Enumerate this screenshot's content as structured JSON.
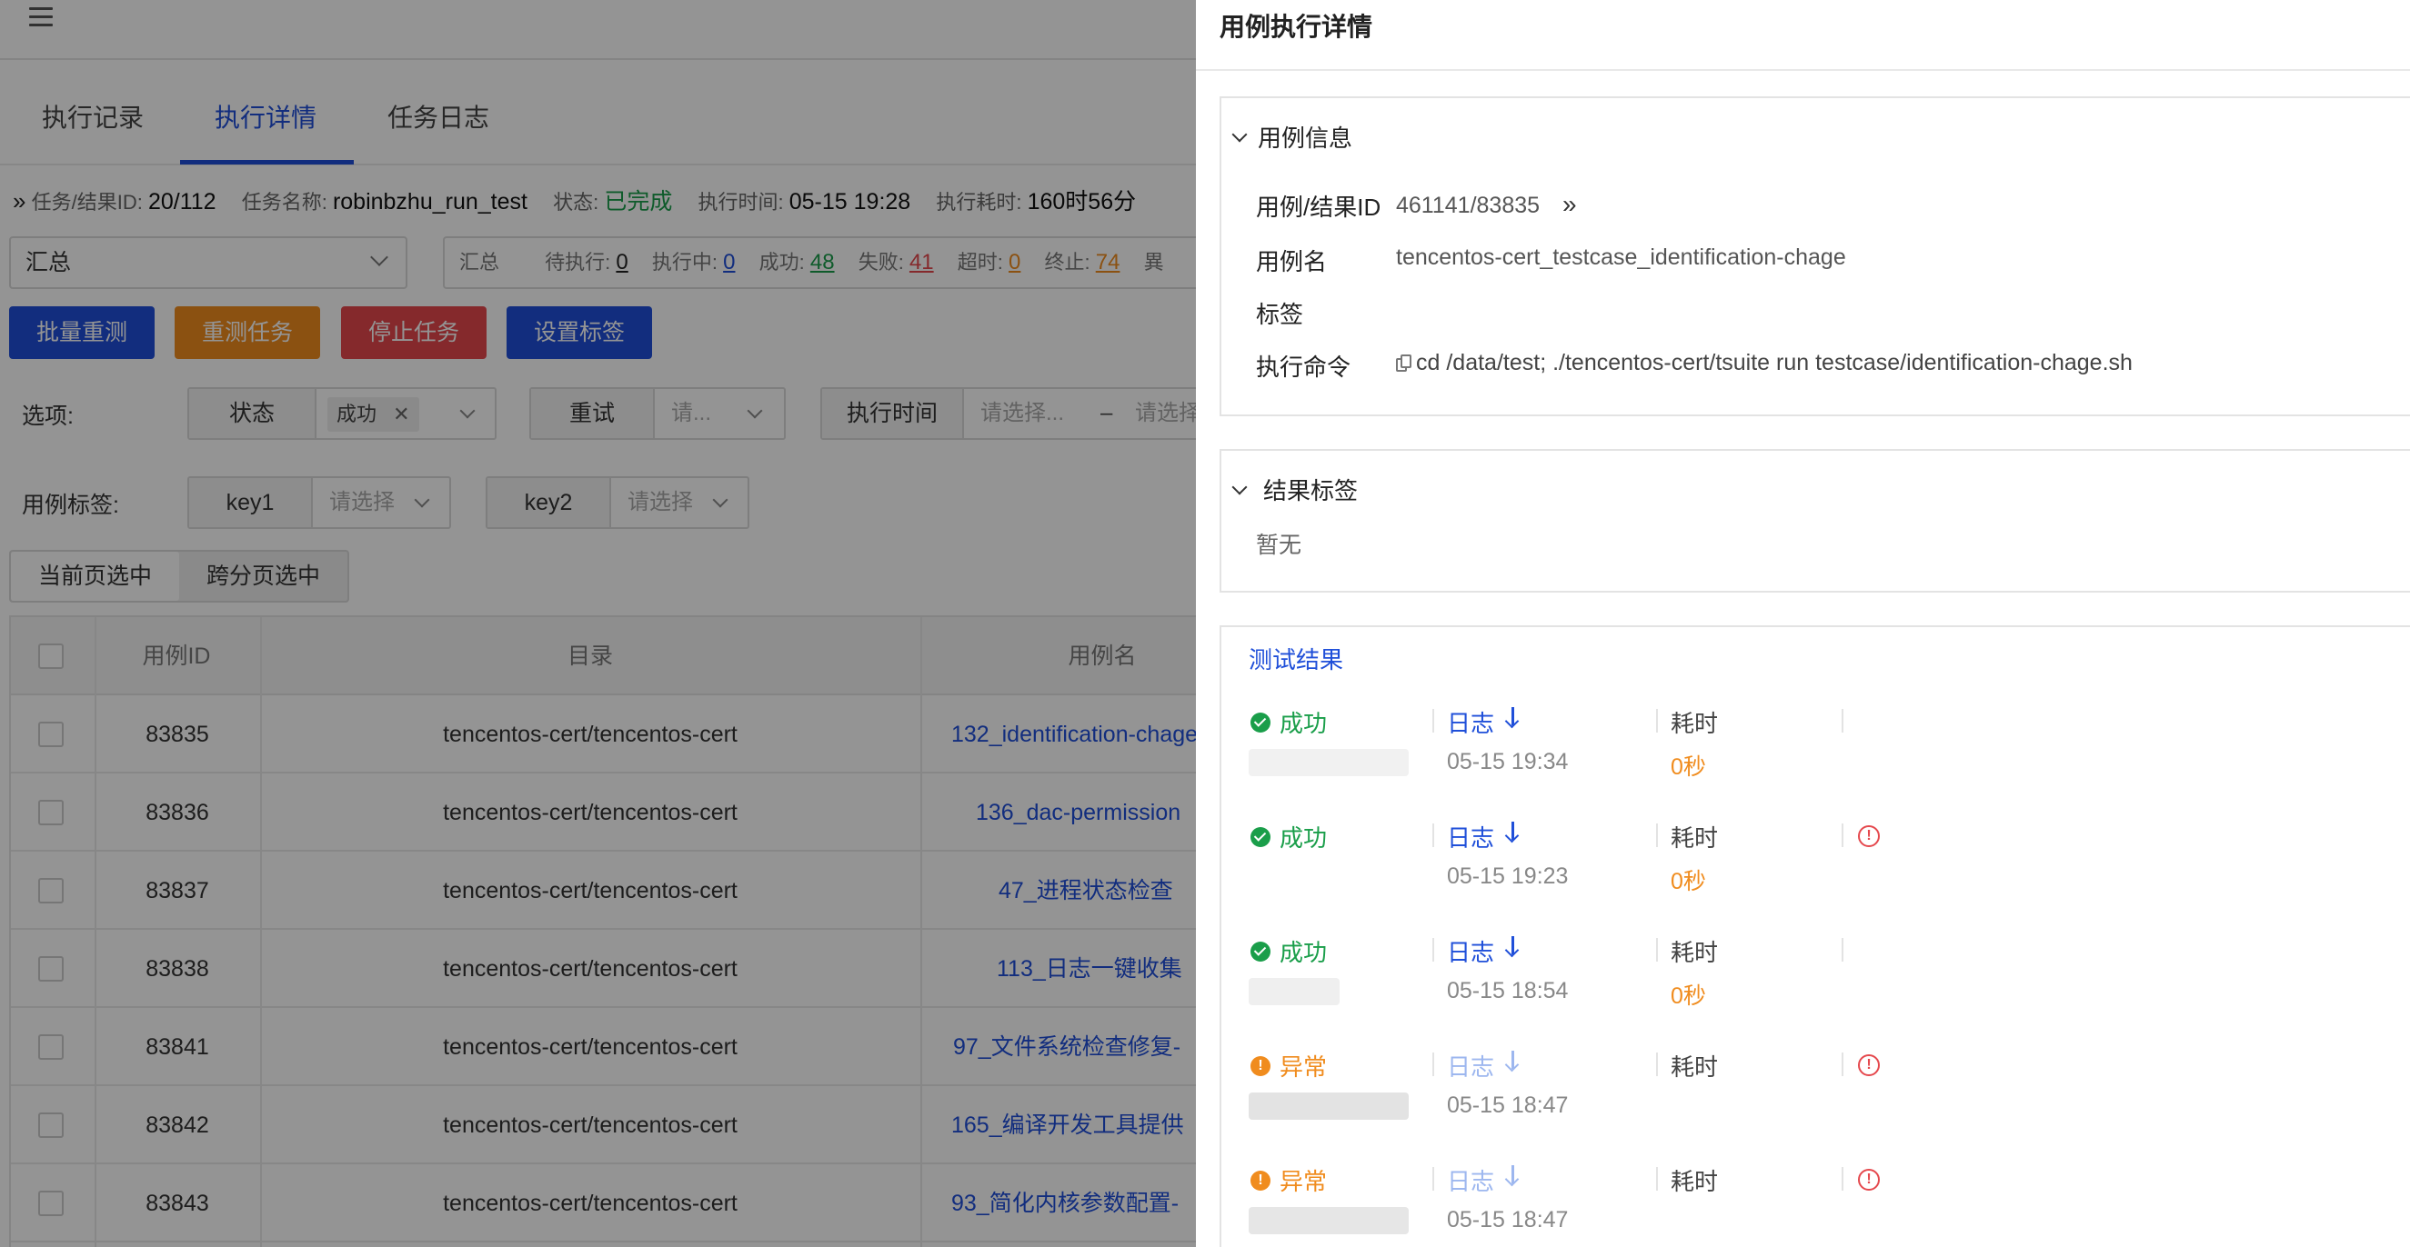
{
  "left": {
    "tabs": [
      "执行记录",
      "执行详情",
      "任务日志"
    ],
    "info": {
      "id_label": "任务/结果ID:",
      "id_value": "20/112",
      "name_label": "任务名称:",
      "name_value": "robinbzhu_run_test",
      "status_label": "状态:",
      "status_value": "已完成",
      "time_label": "执行时间:",
      "time_value": "05-15 19:28",
      "cost_label": "执行耗时:",
      "cost_value": "160时56分"
    },
    "summary_select": "汇总",
    "stats": {
      "title": "汇总",
      "pending_label": "待执行:",
      "pending": "0",
      "running_label": "执行中:",
      "running": "0",
      "success_label": "成功:",
      "success": "48",
      "fail_label": "失败:",
      "fail": "41",
      "timeout_label": "超时:",
      "timeout": "0",
      "stop_label": "终止:",
      "stop": "74",
      "more": "異"
    },
    "buttons": {
      "batch_retest": "批量重测",
      "retest_task": "重测任务",
      "stop_task": "停止任务",
      "set_tag": "设置标签"
    },
    "filters": {
      "options_label": "选项:",
      "status_label": "状态",
      "status_tag": "成功",
      "retry_label": "重试",
      "retry_placeholder": "请...",
      "exec_time_label": "执行时间",
      "exec_time_start": "请选择...",
      "exec_time_dash": "–",
      "exec_time_end": "请选择",
      "case_tag_label": "用例标签:",
      "key1": "key1",
      "key1_placeholder": "请选择",
      "key2": "key2",
      "key2_placeholder": "请选择"
    },
    "segment": [
      "当前页选中",
      "跨分页选中"
    ],
    "table": {
      "headers": [
        "用例ID",
        "目录",
        "用例名"
      ],
      "rows": [
        {
          "id": "83835",
          "dir": "tencentos-cert/tencentos-cert",
          "name": "132_identification-chage"
        },
        {
          "id": "83836",
          "dir": "tencentos-cert/tencentos-cert",
          "name": "136_dac-permission"
        },
        {
          "id": "83837",
          "dir": "tencentos-cert/tencentos-cert",
          "name": "47_进程状态检查"
        },
        {
          "id": "83838",
          "dir": "tencentos-cert/tencentos-cert",
          "name": "113_日志一键收集"
        },
        {
          "id": "83841",
          "dir": "tencentos-cert/tencentos-cert",
          "name": "97_文件系统检查修复-"
        },
        {
          "id": "83842",
          "dir": "tencentos-cert/tencentos-cert",
          "name": "165_编译开发工具提供"
        },
        {
          "id": "83843",
          "dir": "tencentos-cert/tencentos-cert",
          "name": "93_简化内核参数配置-"
        }
      ]
    }
  },
  "drawer": {
    "title": "用例执行详情",
    "case_info": {
      "title": "用例信息",
      "id_label": "用例/结果ID",
      "id_value": "461141/83835",
      "name_label": "用例名",
      "name_value": "tencentos-cert_testcase_identification-chage",
      "tags_label": "标签",
      "cmd_label": "执行命令",
      "cmd_value": "cd /data/test; ./tencentos-cert/tsuite run testcase/identification-chage.sh"
    },
    "result_tags": {
      "title": "结果标签",
      "empty": "暂无"
    },
    "test_results": {
      "title": "测试结果",
      "log_label": "日志",
      "cost_label": "耗时",
      "items": [
        {
          "status": "成功",
          "time": "05-15 19:34",
          "cost": "0秒"
        },
        {
          "status": "成功",
          "time": "05-15 19:23",
          "cost": "0秒"
        },
        {
          "status": "成功",
          "time": "05-15 18:54",
          "cost": "0秒"
        },
        {
          "status": "异常",
          "time": "05-15 18:47",
          "cost": ""
        },
        {
          "status": "异常",
          "time": "05-15 18:47",
          "cost": ""
        }
      ]
    }
  },
  "colors": {
    "primary": "#1f4fd9",
    "success": "#1a9e4a",
    "warning": "#f08c1e",
    "danger": "#e5484d",
    "retest_button": "#f08c1e",
    "stop_button": "#e5484d"
  }
}
